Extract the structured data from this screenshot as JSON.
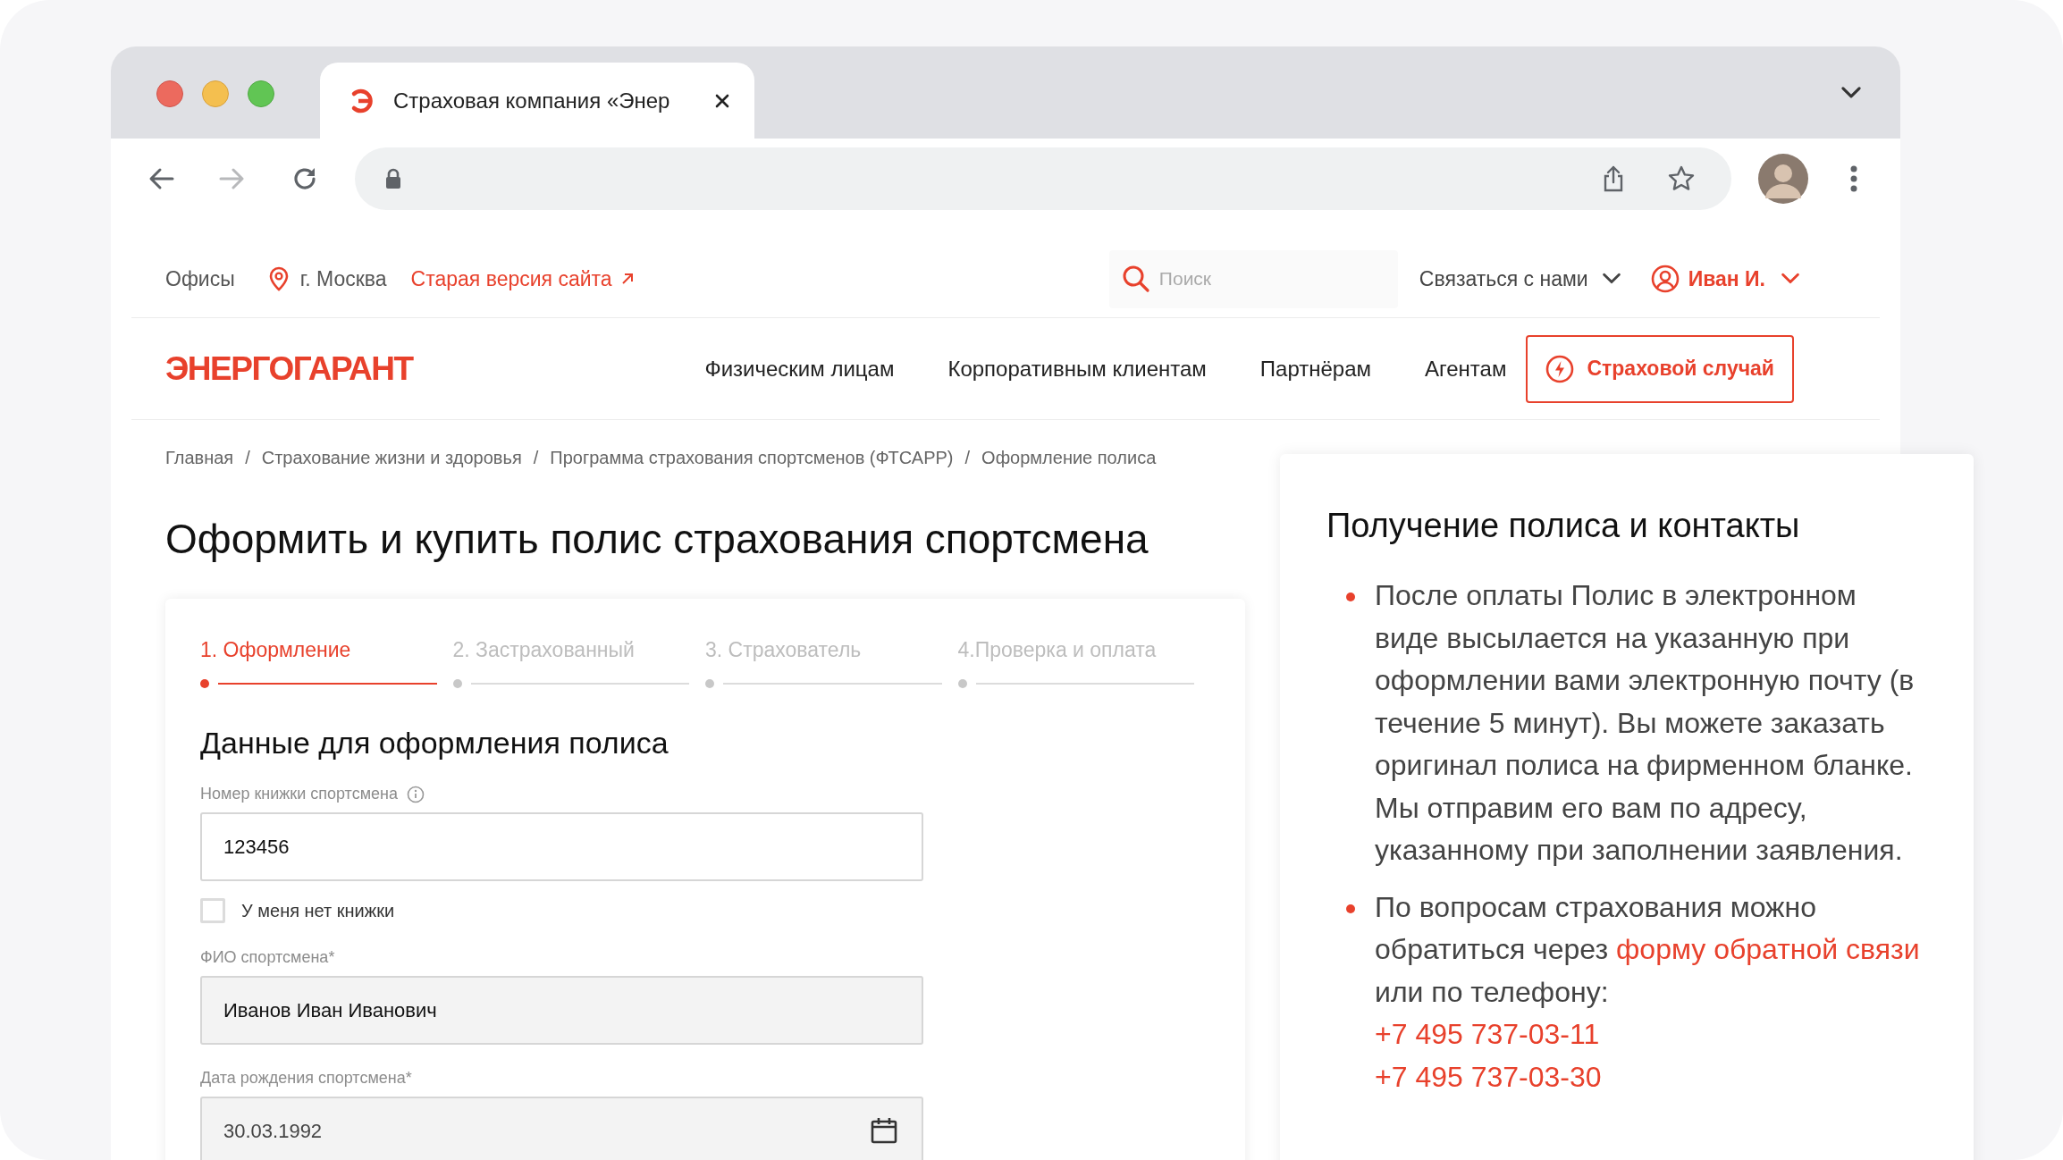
{
  "browser": {
    "tab": {
      "title": "Страховая компания «Энер"
    }
  },
  "top_bar": {
    "offices": "Офисы",
    "city": "г. Москва",
    "old_site_link": "Старая версия сайта",
    "search": {
      "placeholder": "Поиск"
    },
    "contact": "Связаться с нами",
    "user": "Иван И."
  },
  "nav": {
    "logo": "ЭНЕРГОГАРАНТ",
    "items": [
      "Физическим лицам",
      "Корпоративным клиентам",
      "Партнёрам",
      "Агентам"
    ],
    "claim_button": "Страховой случай"
  },
  "breadcrumbs": {
    "items": [
      "Главная",
      "Страхование жизни и здоровья",
      "Программа страхования спортсменов (ФТСАРР)",
      "Оформление полиса"
    ],
    "separators": [
      "/",
      "/",
      "/"
    ]
  },
  "title": "Оформить и купить полис страхования спортсмена",
  "form": {
    "steps": [
      {
        "label": "1. Оформление",
        "selected": true
      },
      {
        "label": "2. Застрахованный",
        "selected": false
      },
      {
        "label": "3. Страхователь",
        "selected": false
      },
      {
        "label": "4.Проверка и оплата",
        "selected": false
      }
    ],
    "section_title": "Данные для оформления полиса",
    "fields": [
      {
        "kind": "text",
        "label": "Номер книжки спортсмена",
        "info": true,
        "value": "123456",
        "disabled": false
      },
      {
        "kind": "checkbox",
        "label": "У меня нет книжки",
        "checked": false
      },
      {
        "kind": "text",
        "label": "ФИО спортсмена*",
        "info": false,
        "value": "Иванов Иван Иванович",
        "disabled": true
      },
      {
        "kind": "date",
        "label": "Дата рождения спортсмена*",
        "info": false,
        "value": "30.03.1992",
        "disabled": true
      }
    ]
  },
  "right_panel": {
    "title": "Получение полиса и контакты",
    "items": [
      {
        "text": "После оплаты Полис в электронном виде высылается на указанную при оформлении вами электронную почту (в течение 5 минут). Вы можете заказать оригинал полиса на фирменном бланке. Мы отправим его вам по адресу, указанному при заполнении заявления."
      },
      {
        "text": "По вопросам страхования можно обратиться через ",
        "link": "форму обратной связи",
        "text_after": " или по телефону:",
        "phones": [
          "+7 495 737-03-11",
          "+7 495 737-03-30"
        ]
      }
    ]
  }
}
